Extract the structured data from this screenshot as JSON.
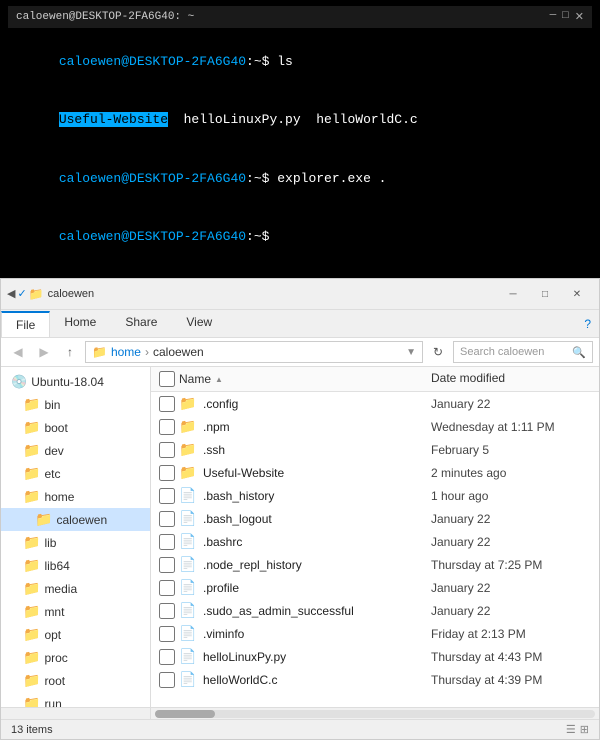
{
  "terminal": {
    "title": "caloewen@DESKTOP-2FA6G40: ~",
    "lines": [
      {
        "text": "caloewen@DESKTOP-2FA6G40:~$ ls",
        "type": "command"
      },
      {
        "part1": "Useful-Website",
        "part2": "  helloLinuxPy.py  helloWorldC.c",
        "type": "ls-output"
      },
      {
        "text": "caloewen@DESKTOP-2FA6G40:~$ explorer.exe .",
        "type": "command"
      },
      {
        "text": "caloewen@DESKTOP-2FA6G40:~$ ",
        "type": "command"
      }
    ]
  },
  "explorer": {
    "title": "caloewen",
    "ribbon_tabs": [
      "File",
      "Home",
      "Share",
      "View"
    ],
    "active_tab": "Home",
    "address": {
      "path_parts": [
        "home",
        "caloewen"
      ],
      "search_placeholder": "Search caloewen"
    },
    "nav_tree": [
      {
        "label": "Ubuntu-18.04",
        "type": "drive",
        "indent": 0
      },
      {
        "label": "bin",
        "type": "folder",
        "indent": 1
      },
      {
        "label": "boot",
        "type": "folder",
        "indent": 1
      },
      {
        "label": "dev",
        "type": "folder",
        "indent": 1
      },
      {
        "label": "etc",
        "type": "folder",
        "indent": 1
      },
      {
        "label": "home",
        "type": "folder",
        "indent": 1
      },
      {
        "label": "caloewen",
        "type": "folder",
        "indent": 2,
        "selected": true
      },
      {
        "label": "lib",
        "type": "folder",
        "indent": 1
      },
      {
        "label": "lib64",
        "type": "folder",
        "indent": 1
      },
      {
        "label": "media",
        "type": "folder",
        "indent": 1
      },
      {
        "label": "mnt",
        "type": "folder",
        "indent": 1
      },
      {
        "label": "opt",
        "type": "folder",
        "indent": 1
      },
      {
        "label": "proc",
        "type": "folder",
        "indent": 1
      },
      {
        "label": "root",
        "type": "folder",
        "indent": 1
      },
      {
        "label": "run",
        "type": "folder",
        "indent": 1
      }
    ],
    "columns": {
      "name": "Name",
      "modified": "Date modified"
    },
    "files": [
      {
        "name": ".config",
        "type": "folder",
        "modified": "January 22"
      },
      {
        "name": ".npm",
        "type": "folder",
        "modified": "Wednesday at 1:11 PM"
      },
      {
        "name": ".ssh",
        "type": "folder",
        "modified": "February 5"
      },
      {
        "name": "Useful-Website",
        "type": "folder",
        "modified": "2 minutes ago"
      },
      {
        "name": ".bash_history",
        "type": "file",
        "modified": "1 hour ago"
      },
      {
        "name": ".bash_logout",
        "type": "file",
        "modified": "January 22"
      },
      {
        "name": ".bashrc",
        "type": "file",
        "modified": "January 22"
      },
      {
        "name": ".node_repl_history",
        "type": "file",
        "modified": "Thursday at 7:25 PM"
      },
      {
        "name": ".profile",
        "type": "file",
        "modified": "January 22"
      },
      {
        "name": ".sudo_as_admin_successful",
        "type": "file",
        "modified": "January 22"
      },
      {
        "name": ".viminfo",
        "type": "file",
        "modified": "Friday at 2:13 PM"
      },
      {
        "name": "helloLinuxPy.py",
        "type": "py",
        "modified": "Thursday at 4:43 PM"
      },
      {
        "name": "helloWorldC.c",
        "type": "c",
        "modified": "Thursday at 4:39 PM"
      }
    ],
    "status": "13 items"
  }
}
